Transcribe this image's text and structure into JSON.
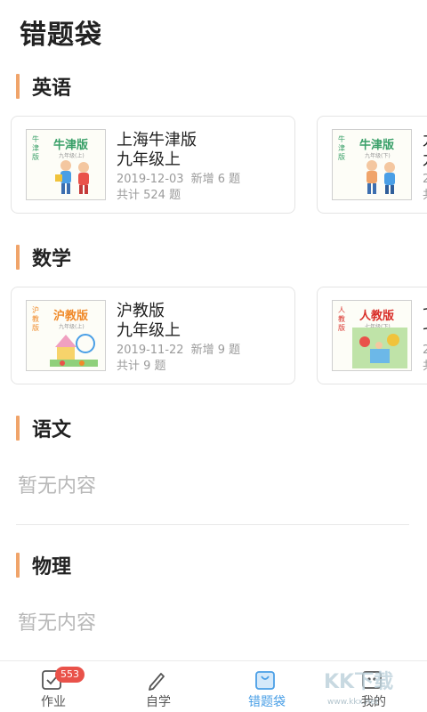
{
  "page": {
    "title": "错题袋"
  },
  "sections": {
    "english": {
      "label": "英语",
      "card1": {
        "cover_title": "牛津版",
        "cover_side": "牛津版",
        "cover_sub": "九年级(上)",
        "name": "上海牛津版",
        "grade": "九年级上",
        "date": "2019-12-03",
        "new": "新增 6 题",
        "total": "共计 524 题"
      },
      "card2": {
        "cover_title": "牛津版",
        "cover_side": "牛津版",
        "cover_sub": "九年级(下)",
        "name": "九",
        "grade": "九",
        "date": "2",
        "total": "共"
      }
    },
    "math": {
      "label": "数学",
      "card1": {
        "cover_title": "沪教版",
        "cover_side": "沪教版",
        "cover_sub": "九年级(上)",
        "name": "沪教版",
        "grade": "九年级上",
        "date": "2019-11-22",
        "new": "新增 9 题",
        "total": "共计 9 题"
      },
      "card2": {
        "cover_title": "人教版",
        "cover_side": "人教版",
        "cover_sub": "七年级(下)",
        "name": "七",
        "grade": "七",
        "date": "2",
        "total": "共"
      }
    },
    "chinese": {
      "label": "语文",
      "empty": "暂无内容"
    },
    "physics": {
      "label": "物理",
      "empty": "暂无内容"
    }
  },
  "tabbar": {
    "homework": {
      "label": "作业",
      "badge": "553"
    },
    "self_study": {
      "label": "自学"
    },
    "mistakes": {
      "label": "错题袋"
    },
    "mine": {
      "label": "我的"
    }
  },
  "watermark": {
    "brand": "KK下载",
    "url": "www.kkx.net"
  },
  "colors": {
    "accent": "#4a9fe6",
    "section_bar": "#f0a46a",
    "badge": "#e9524a",
    "cover_green": "#3aa069",
    "cover_orange": "#f08a2a",
    "cover_red": "#d9302a"
  }
}
